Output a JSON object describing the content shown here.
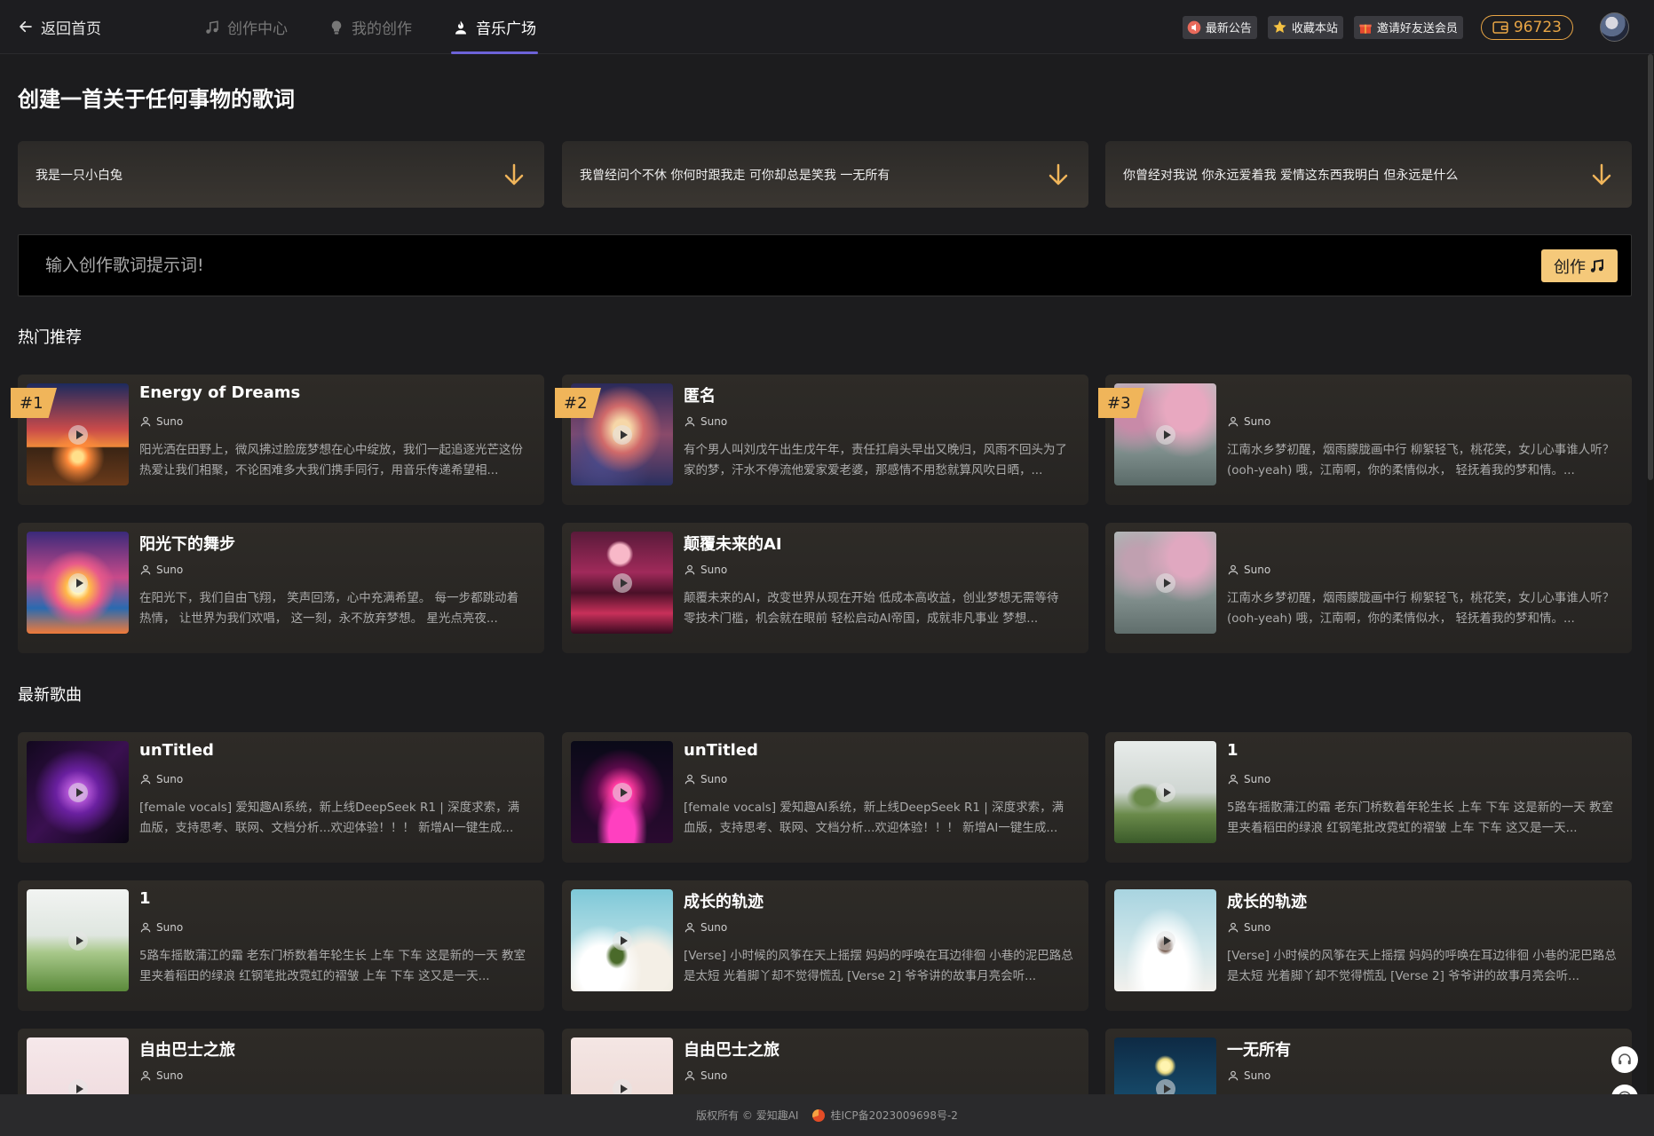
{
  "header": {
    "back_label": "返回首页",
    "tabs": [
      {
        "label": "创作中心",
        "icon": "music-note-icon"
      },
      {
        "label": "我的创作",
        "icon": "bulb-icon"
      },
      {
        "label": "音乐广场",
        "icon": "user-flame-icon"
      }
    ],
    "active_tab": "音乐广场",
    "buttons": [
      {
        "label": "最新公告",
        "icon": "megaphone-icon",
        "color": "#e86a5b"
      },
      {
        "label": "收藏本站",
        "icon": "star-icon",
        "color": "#f5c243"
      },
      {
        "label": "邀请好友送会员",
        "icon": "gift-icon",
        "color": "#e6492f"
      }
    ],
    "coins": "96723"
  },
  "main": {
    "title": "创建一首关于任何事物的歌词",
    "prompts": [
      "我是一只小白兔",
      "我曾经问个不休 你何时跟我走 可你却总是笑我 一无所有",
      "你曾经对我说 你永远爱着我 爱情这东西我明白 但永远是什么"
    ],
    "input_placeholder": "输入创作歌词提示词!",
    "create_label": "创作"
  },
  "hot": {
    "title": "热门推荐",
    "songs": [
      {
        "rank": "#1",
        "title": "Energy of Dreams",
        "artist": "Suno",
        "lyrics": "阳光洒在田野上，微风拂过脸庞梦想在心中绽放，我们一起追逐光芒这份热爱让我们相聚，不论困难多大我们携手同行，用音乐传递希望相..."
      },
      {
        "rank": "#2",
        "title": "匿名",
        "artist": "Suno",
        "lyrics": "有个男人叫刘戊午出生戊午年，责任扛肩头早出又晚归，风雨不回头为了家的梦，汗水不停流他爱家爱老婆，那感情不用愁就算风吹日晒，..."
      },
      {
        "rank": "#3",
        "title": "",
        "artist": "Suno",
        "lyrics": "江南水乡梦初醒，烟雨朦胧画中行 柳絮轻飞，桃花笑，女儿心事谁人听？ (ooh-yeah) 哦，江南啊，你的柔情似水， 轻抚着我的梦和情。..."
      },
      {
        "rank": "",
        "title": "阳光下的舞步",
        "artist": "Suno",
        "lyrics": "在阳光下，我们自由飞翔， 笑声回荡，心中充满希望。 每一步都跳动着热情， 让世界为我们欢唱， 这一刻，永不放弃梦想。 星光点亮夜..."
      },
      {
        "rank": "",
        "title": "颠覆未来的AI",
        "artist": "Suno",
        "lyrics": "颠覆未来的AI，改变世界从现在开始 低成本高收益，创业梦想无需等待 零技术门槛，机会就在眼前 轻松启动AI帝国，成就非凡事业 梦想..."
      },
      {
        "rank": "",
        "title": "",
        "artist": "Suno",
        "lyrics": "江南水乡梦初醒，烟雨朦胧画中行 柳絮轻飞，桃花笑，女儿心事谁人听？ (ooh-yeah) 哦，江南啊，你的柔情似水， 轻抚着我的梦和情。..."
      }
    ]
  },
  "latest": {
    "title": "最新歌曲",
    "songs": [
      {
        "title": "unTitled",
        "artist": "Suno",
        "lyrics": "[female vocals] 爱知趣AI系统，新上线DeepSeek R1 | 深度求索，满血版，支持思考、联网、文档分析...欢迎体验！！！ 新增AI一键生成..."
      },
      {
        "title": "unTitled",
        "artist": "Suno",
        "lyrics": "[female vocals] 爱知趣AI系统，新上线DeepSeek R1 | 深度求索，满血版，支持思考、联网、文档分析...欢迎体验！！！ 新增AI一键生成..."
      },
      {
        "title": "1",
        "artist": "Suno",
        "lyrics": "5路车摇散蒲江的霜 老东门桥数着年轮生长 上车 下车 这是新的一天 教室里夹着稻田的绿浪 红钢笔批改霓虹的褶皱 上车 下车 这又是一天..."
      },
      {
        "title": "1",
        "artist": "Suno",
        "lyrics": "5路车摇散蒲江的霜 老东门桥数着年轮生长 上车 下车 这是新的一天 教室里夹着稻田的绿浪 红钢笔批改霓虹的褶皱 上车 下车 这又是一天..."
      },
      {
        "title": "成长的轨迹",
        "artist": "Suno",
        "lyrics": "[Verse] 小时候的风筝在天上摇摆 妈妈的呼唤在耳边徘徊 小巷的泥巴路总是太短 光着脚丫却不觉得慌乱 [Verse 2] 爷爷讲的故事月亮会听..."
      },
      {
        "title": "成长的轨迹",
        "artist": "Suno",
        "lyrics": "[Verse] 小时候的风筝在天上摇摆 妈妈的呼唤在耳边徘徊 小巷的泥巴路总是太短 光着脚丫却不觉得慌乱 [Verse 2] 爷爷讲的故事月亮会听..."
      },
      {
        "title": "自由巴士之旅",
        "artist": "Suno",
        "lyrics": ""
      },
      {
        "title": "自由巴士之旅",
        "artist": "Suno",
        "lyrics": ""
      },
      {
        "title": "一无所有",
        "artist": "Suno",
        "lyrics": ""
      }
    ]
  },
  "footer": {
    "copyright": "版权所有 © 爱知趣AI",
    "icp": "桂ICP备2023009698号-2"
  },
  "floating": [
    "headset-icon",
    "help-icon"
  ]
}
